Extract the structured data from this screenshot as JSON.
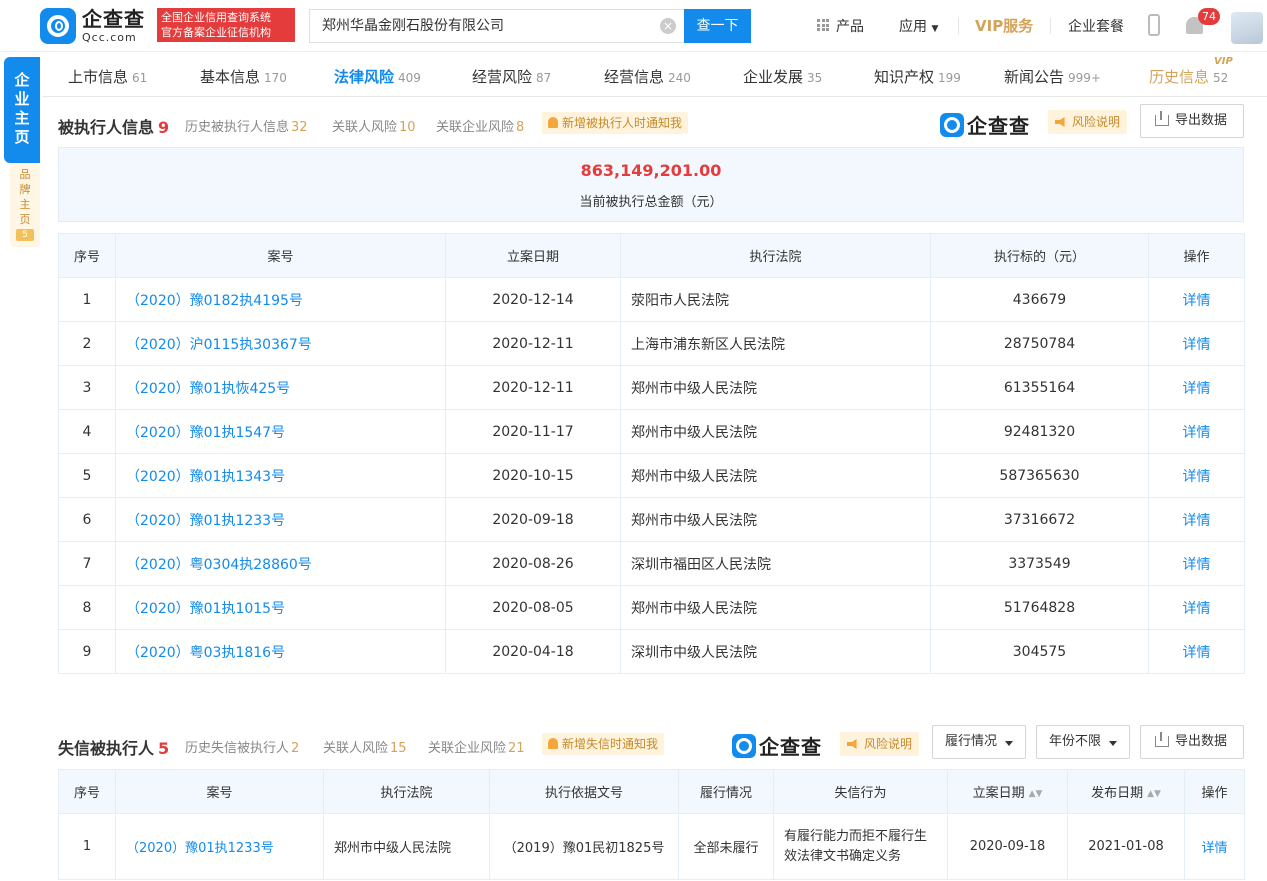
{
  "brand": {
    "logo_cn": "企查查",
    "logo_en": "Qcc.com",
    "cert_line1": "全国企业信用查询系统",
    "cert_line2": "官方备案企业征信机构"
  },
  "search": {
    "value": "郑州华晶金刚石股份有限公司",
    "button": "查一下"
  },
  "topnav": {
    "product": "产品",
    "apps": "应用",
    "vip": "VIP服务",
    "package": "企业套餐",
    "notifications": "74"
  },
  "side": {
    "main": "企业主页",
    "brand_page": "品牌主页",
    "brand_count": "5"
  },
  "tabs": [
    {
      "label": "上市信息",
      "count": "61"
    },
    {
      "label": "基本信息",
      "count": "170"
    },
    {
      "label": "法律风险",
      "count": "409"
    },
    {
      "label": "经营风险",
      "count": "87"
    },
    {
      "label": "经营信息",
      "count": "240"
    },
    {
      "label": "企业发展",
      "count": "35"
    },
    {
      "label": "知识产权",
      "count": "199"
    },
    {
      "label": "新闻公告",
      "count": "999+"
    },
    {
      "label": "历史信息",
      "count": "52"
    }
  ],
  "vip_tag": "VIP",
  "section1": {
    "title": "被执行人信息",
    "count": "9",
    "links": [
      {
        "label": "历史被执行人信息",
        "count": "32"
      },
      {
        "label": "关联人风险",
        "count": "10"
      },
      {
        "label": "关联企业风险",
        "count": "8"
      }
    ],
    "notify": "新增被执行人时通知我",
    "brand": "企查查",
    "risk_note": "风险说明",
    "export": "导出数据",
    "total_amount": "863,149,201.00",
    "total_label": "当前被执行总金额（元）",
    "headers": [
      "序号",
      "案号",
      "立案日期",
      "执行法院",
      "执行标的（元）",
      "操作"
    ],
    "rows": [
      {
        "no": "1",
        "case": "（2020）豫0182执4195号",
        "date": "2020-12-14",
        "court": "荥阳市人民法院",
        "amount": "436679",
        "op": "详情"
      },
      {
        "no": "2",
        "case": "（2020）沪0115执30367号",
        "date": "2020-12-11",
        "court": "上海市浦东新区人民法院",
        "amount": "28750784",
        "op": "详情"
      },
      {
        "no": "3",
        "case": "（2020）豫01执恢425号",
        "date": "2020-12-11",
        "court": "郑州市中级人民法院",
        "amount": "61355164",
        "op": "详情"
      },
      {
        "no": "4",
        "case": "（2020）豫01执1547号",
        "date": "2020-11-17",
        "court": "郑州市中级人民法院",
        "amount": "92481320",
        "op": "详情"
      },
      {
        "no": "5",
        "case": "（2020）豫01执1343号",
        "date": "2020-10-15",
        "court": "郑州市中级人民法院",
        "amount": "587365630",
        "op": "详情"
      },
      {
        "no": "6",
        "case": "（2020）豫01执1233号",
        "date": "2020-09-18",
        "court": "郑州市中级人民法院",
        "amount": "37316672",
        "op": "详情"
      },
      {
        "no": "7",
        "case": "（2020）粤0304执28860号",
        "date": "2020-08-26",
        "court": "深圳市福田区人民法院",
        "amount": "3373549",
        "op": "详情"
      },
      {
        "no": "8",
        "case": "（2020）豫01执1015号",
        "date": "2020-08-05",
        "court": "郑州市中级人民法院",
        "amount": "51764828",
        "op": "详情"
      },
      {
        "no": "9",
        "case": "（2020）粤03执1816号",
        "date": "2020-04-18",
        "court": "深圳市中级人民法院",
        "amount": "304575",
        "op": "详情"
      }
    ]
  },
  "section2": {
    "title": "失信被执行人",
    "count": "5",
    "links": [
      {
        "label": "历史失信被执行人",
        "count": "2"
      },
      {
        "label": "关联人风险",
        "count": "15"
      },
      {
        "label": "关联企业风险",
        "count": "21"
      }
    ],
    "notify": "新增失信时通知我",
    "brand": "企查查",
    "risk_note": "风险说明",
    "filter_status": "履行情况",
    "filter_year": "年份不限",
    "export": "导出数据",
    "headers": [
      "序号",
      "案号",
      "执行法院",
      "执行依据文号",
      "履行情况",
      "失信行为",
      "立案日期",
      "发布日期",
      "操作"
    ],
    "rows": [
      {
        "no": "1",
        "case": "（2020）豫01执1233号",
        "court": "郑州市中级人民法院",
        "basis": "（2019）豫01民初1825号",
        "status": "全部未履行",
        "behavior": "有履行能力而拒不履行生效法律文书确定义务",
        "filed": "2020-09-18",
        "published": "2021-01-08",
        "op": "详情"
      }
    ]
  }
}
